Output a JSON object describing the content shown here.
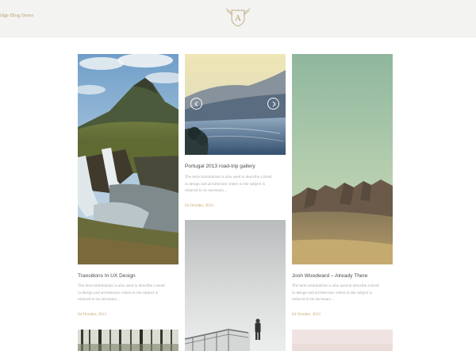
{
  "header": {
    "site_name": "idge Blog Demo",
    "logo_letter": "A"
  },
  "posts": [
    {
      "title": "Transitions In UX Design",
      "excerpt": [
        "The term minimalism is also used to describe a trend",
        "in design and architecture where in the subject is",
        "reduced to its necessary..."
      ],
      "date": "04 October, 2013"
    },
    {
      "title": "Portugal 2013 road-trip gallery",
      "excerpt": [
        "The term minimalism is also used to describe a trend",
        "in design and architecture where in the subject is",
        "reduced to its necessary..."
      ],
      "date": "04 October, 2013"
    },
    {
      "title": "Josh Woodward – Already There",
      "excerpt": [
        "The term minimalism is also used to describe a trend",
        "in design and architecture where in the subject is",
        "reduced to its necessary..."
      ],
      "date": "04 October, 2013"
    }
  ],
  "gallery": {
    "prev_icon": "chevron-left-icon",
    "next_icon": "chevron-right-icon"
  }
}
